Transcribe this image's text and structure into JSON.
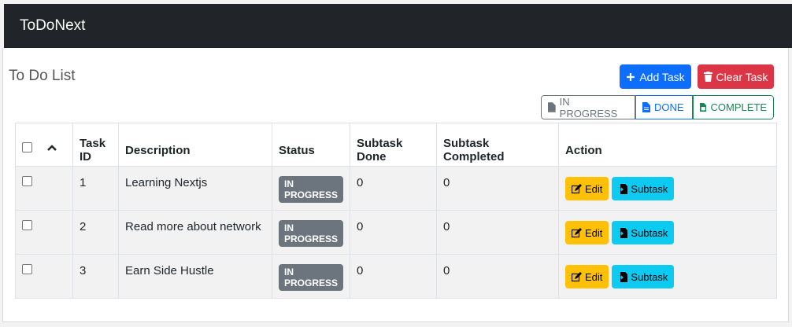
{
  "app": {
    "title": "ToDoNext"
  },
  "header": {
    "title": "To Do List"
  },
  "toolbar": {
    "add_label": "Add Task",
    "clear_label": "Clear Task"
  },
  "filters": {
    "in_progress": "IN PROGRESS",
    "done": "DONE",
    "complete": "COMPLETE"
  },
  "table": {
    "columns": [
      "Task ID",
      "Description",
      "Status",
      "Subtask Done",
      "Subtask Completed",
      "Action"
    ],
    "rows": [
      {
        "id": "1",
        "description": "Learning Nextjs",
        "status": "IN PROGRESS",
        "subtask_done": "0",
        "subtask_completed": "0"
      },
      {
        "id": "2",
        "description": "Read more about network",
        "status": "IN PROGRESS",
        "subtask_done": "0",
        "subtask_completed": "0"
      },
      {
        "id": "3",
        "description": "Earn Side Hustle",
        "status": "IN PROGRESS",
        "subtask_done": "0",
        "subtask_completed": "0"
      }
    ],
    "edit_label": "Edit",
    "subtask_label": "Subtask"
  },
  "colors": {
    "navbar": "#212529",
    "primary": "#0d6efd",
    "danger": "#dc3545",
    "warning": "#ffc107",
    "info": "#0dcaf0",
    "secondary": "#6c757d",
    "success": "#198754"
  },
  "icons": {
    "add": "plus-icon",
    "clear": "trash-icon",
    "filter": "file-icon",
    "edit": "edit-icon",
    "subtask": "file-import-icon",
    "sort": "chevron-up-icon"
  }
}
